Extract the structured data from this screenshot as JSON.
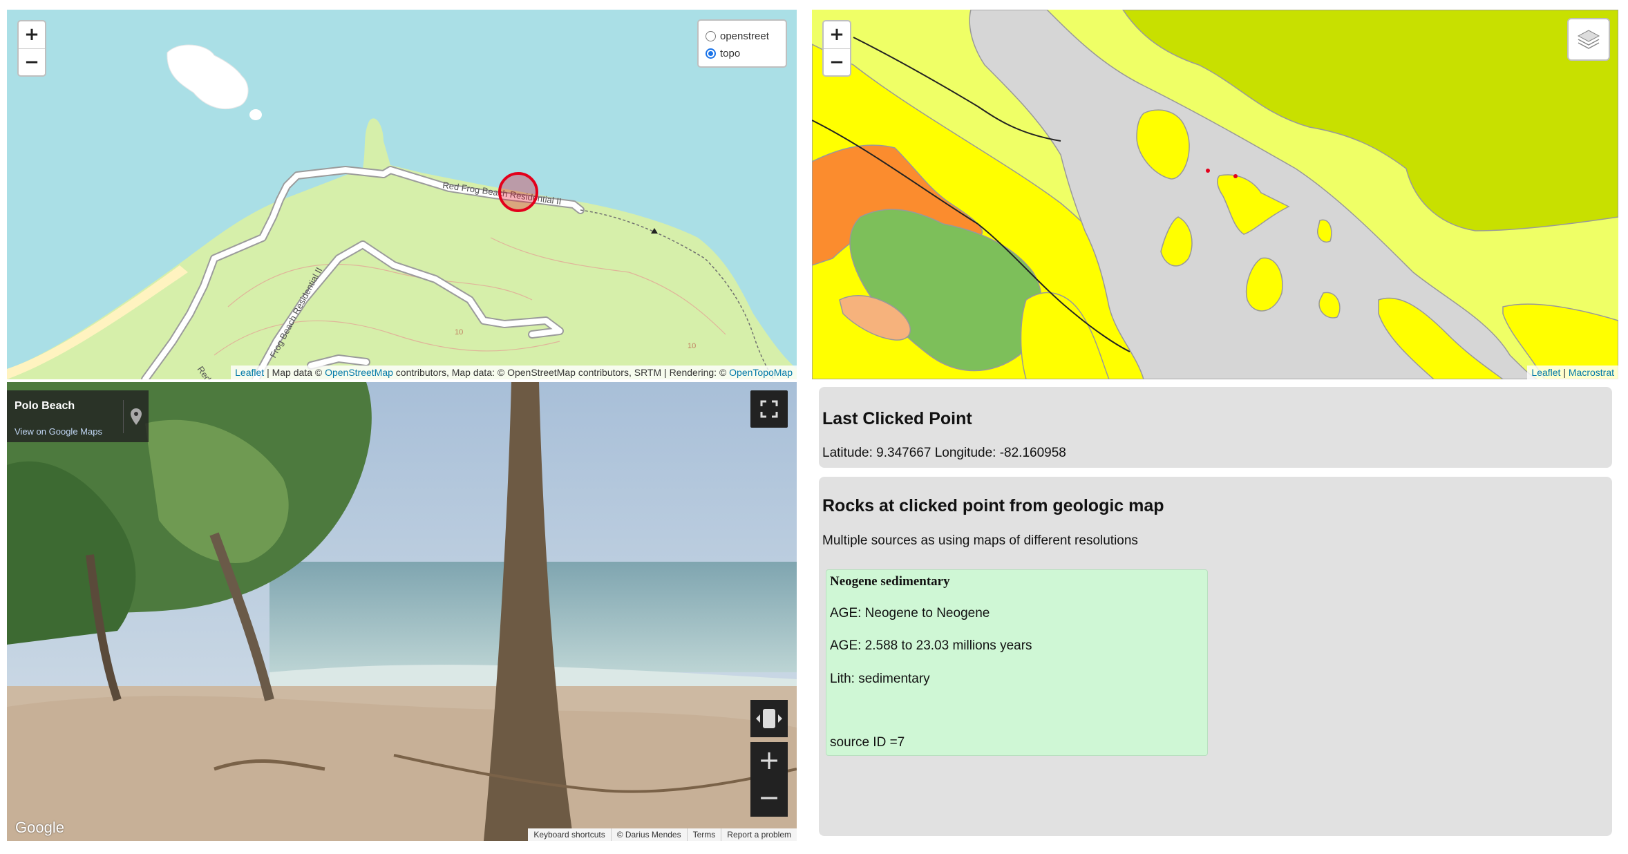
{
  "topo_map": {
    "zoom_in": "+",
    "zoom_out": "−",
    "layers": [
      {
        "label": "openstreet",
        "checked": false
      },
      {
        "label": "topo",
        "checked": true
      }
    ],
    "road_labels": [
      "Red Frog Beach Residential II",
      "Frog Beach Residential II",
      "Red F"
    ],
    "contour_labels": [
      "10",
      "10"
    ],
    "attribution": {
      "leaflet": "Leaflet",
      "sep": " | Map data © ",
      "osm": "OpenStreetMap",
      "mid": " contributors, Map data: © OpenStreetMap contributors, SRTM | Rendering: © ",
      "otm": "OpenTopoMap"
    },
    "colors": {
      "water": "#aadfe6",
      "land": "#d6efaa",
      "road": "#ffffff",
      "marker": "#e3001b"
    }
  },
  "geo_map": {
    "zoom_in": "+",
    "zoom_out": "−",
    "layers_icon": "layers-icon",
    "attribution": {
      "leaflet": "Leaflet",
      "sep": " | ",
      "macrostrat": "Macrostrat"
    },
    "colors": {
      "yellow": "#ffff00",
      "pale_yellow": "#efff66",
      "lime": "#c8e000",
      "orange": "#fb8c2e",
      "green": "#7dbf5a",
      "gray": "#d6d6d6",
      "salmon": "#f6b27c"
    }
  },
  "street_view": {
    "place": "Polo Beach",
    "view_link": "View on Google Maps",
    "google": "Google",
    "footer": [
      "Keyboard shortcuts",
      "© Darius Mendes",
      "Terms",
      "Report a problem"
    ],
    "zoom_in": "+",
    "zoom_out": "−"
  },
  "last_clicked": {
    "title": "Last Clicked Point",
    "coords": "Latitude: 9.347667 Longitude: -82.160958"
  },
  "rocks": {
    "title": "Rocks at clicked point from geologic map",
    "subtitle": "Multiple sources as using maps of different resolutions",
    "name": "Neogene sedimentary",
    "age": "AGE: Neogene to Neogene",
    "age_range": "AGE: 2.588 to 23.03 millions years",
    "lith": "Lith: sedimentary",
    "source": "source ID =7"
  }
}
